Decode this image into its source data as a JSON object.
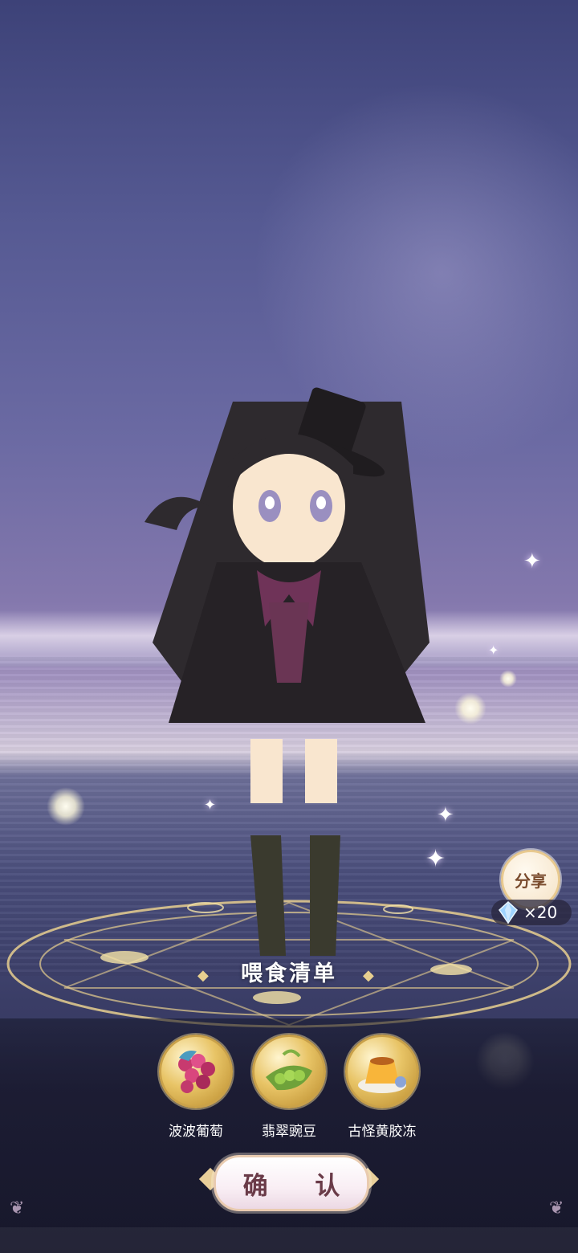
{
  "feeding_list": {
    "title": "喂食清单",
    "items": [
      {
        "name": "波波葡萄",
        "icon": "grape-icon"
      },
      {
        "name": "翡翠豌豆",
        "icon": "pea-icon"
      },
      {
        "name": "古怪黄胶冻",
        "icon": "pudding-icon"
      }
    ]
  },
  "share": {
    "label": "分享",
    "reward_icon": "diamond-icon",
    "reward_count": "×20"
  },
  "confirm_label": "确 认",
  "colors": {
    "accent_gold": "#e8c98f",
    "confirm_text": "#6a3b48"
  }
}
